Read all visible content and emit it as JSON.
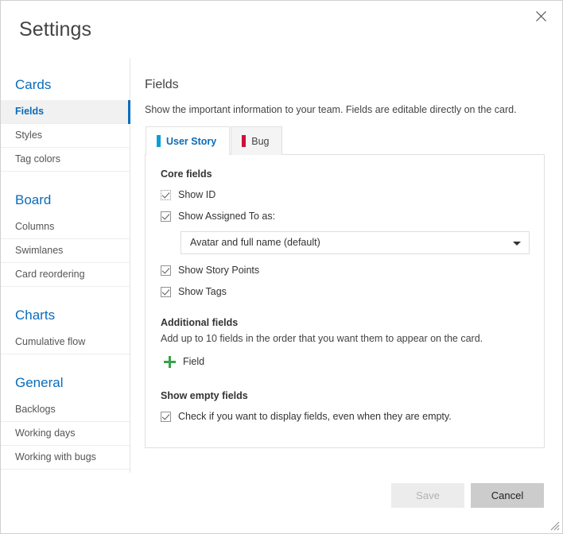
{
  "window": {
    "title": "Settings",
    "close_icon": "close-icon",
    "resize_grip_icon": "resize-grip-icon"
  },
  "sidebar": {
    "groups": [
      {
        "title": "Cards",
        "items": [
          {
            "label": "Fields",
            "selected": true
          },
          {
            "label": "Styles",
            "selected": false
          },
          {
            "label": "Tag colors",
            "selected": false
          }
        ]
      },
      {
        "title": "Board",
        "items": [
          {
            "label": "Columns",
            "selected": false
          },
          {
            "label": "Swimlanes",
            "selected": false
          },
          {
            "label": "Card reordering",
            "selected": false
          }
        ]
      },
      {
        "title": "Charts",
        "items": [
          {
            "label": "Cumulative flow",
            "selected": false
          }
        ]
      },
      {
        "title": "General",
        "items": [
          {
            "label": "Backlogs",
            "selected": false
          },
          {
            "label": "Working days",
            "selected": false
          },
          {
            "label": "Working with bugs",
            "selected": false
          }
        ]
      }
    ]
  },
  "main": {
    "title": "Fields",
    "description": "Show the important information to your team. Fields are editable directly on the card.",
    "tabs": [
      {
        "label": "User Story",
        "color": "#0a9ed9",
        "active": true
      },
      {
        "label": "Bug",
        "color": "#cc1236",
        "active": false
      }
    ],
    "core_fields": {
      "heading": "Core fields",
      "show_id": {
        "label": "Show ID",
        "checked": true
      },
      "show_assigned_to": {
        "label": "Show Assigned To as:",
        "checked": true
      },
      "assigned_to_value": "Avatar and full name (default)",
      "show_story_points": {
        "label": "Show Story Points",
        "checked": true
      },
      "show_tags": {
        "label": "Show Tags",
        "checked": true
      }
    },
    "additional_fields": {
      "heading": "Additional fields",
      "description": "Add up to 10 fields in the order that you want them to appear on the card.",
      "add_label": "Field",
      "add_icon": "plus-icon"
    },
    "empty_fields": {
      "heading": "Show empty fields",
      "checkbox": {
        "label": "Check if you want to display fields, even when they are empty.",
        "checked": true
      }
    }
  },
  "footer": {
    "save_label": "Save",
    "cancel_label": "Cancel"
  },
  "colors": {
    "accent": "#0a6cbb",
    "user_story": "#0a9ed9",
    "bug": "#cc1236",
    "add": "#37a24a"
  }
}
